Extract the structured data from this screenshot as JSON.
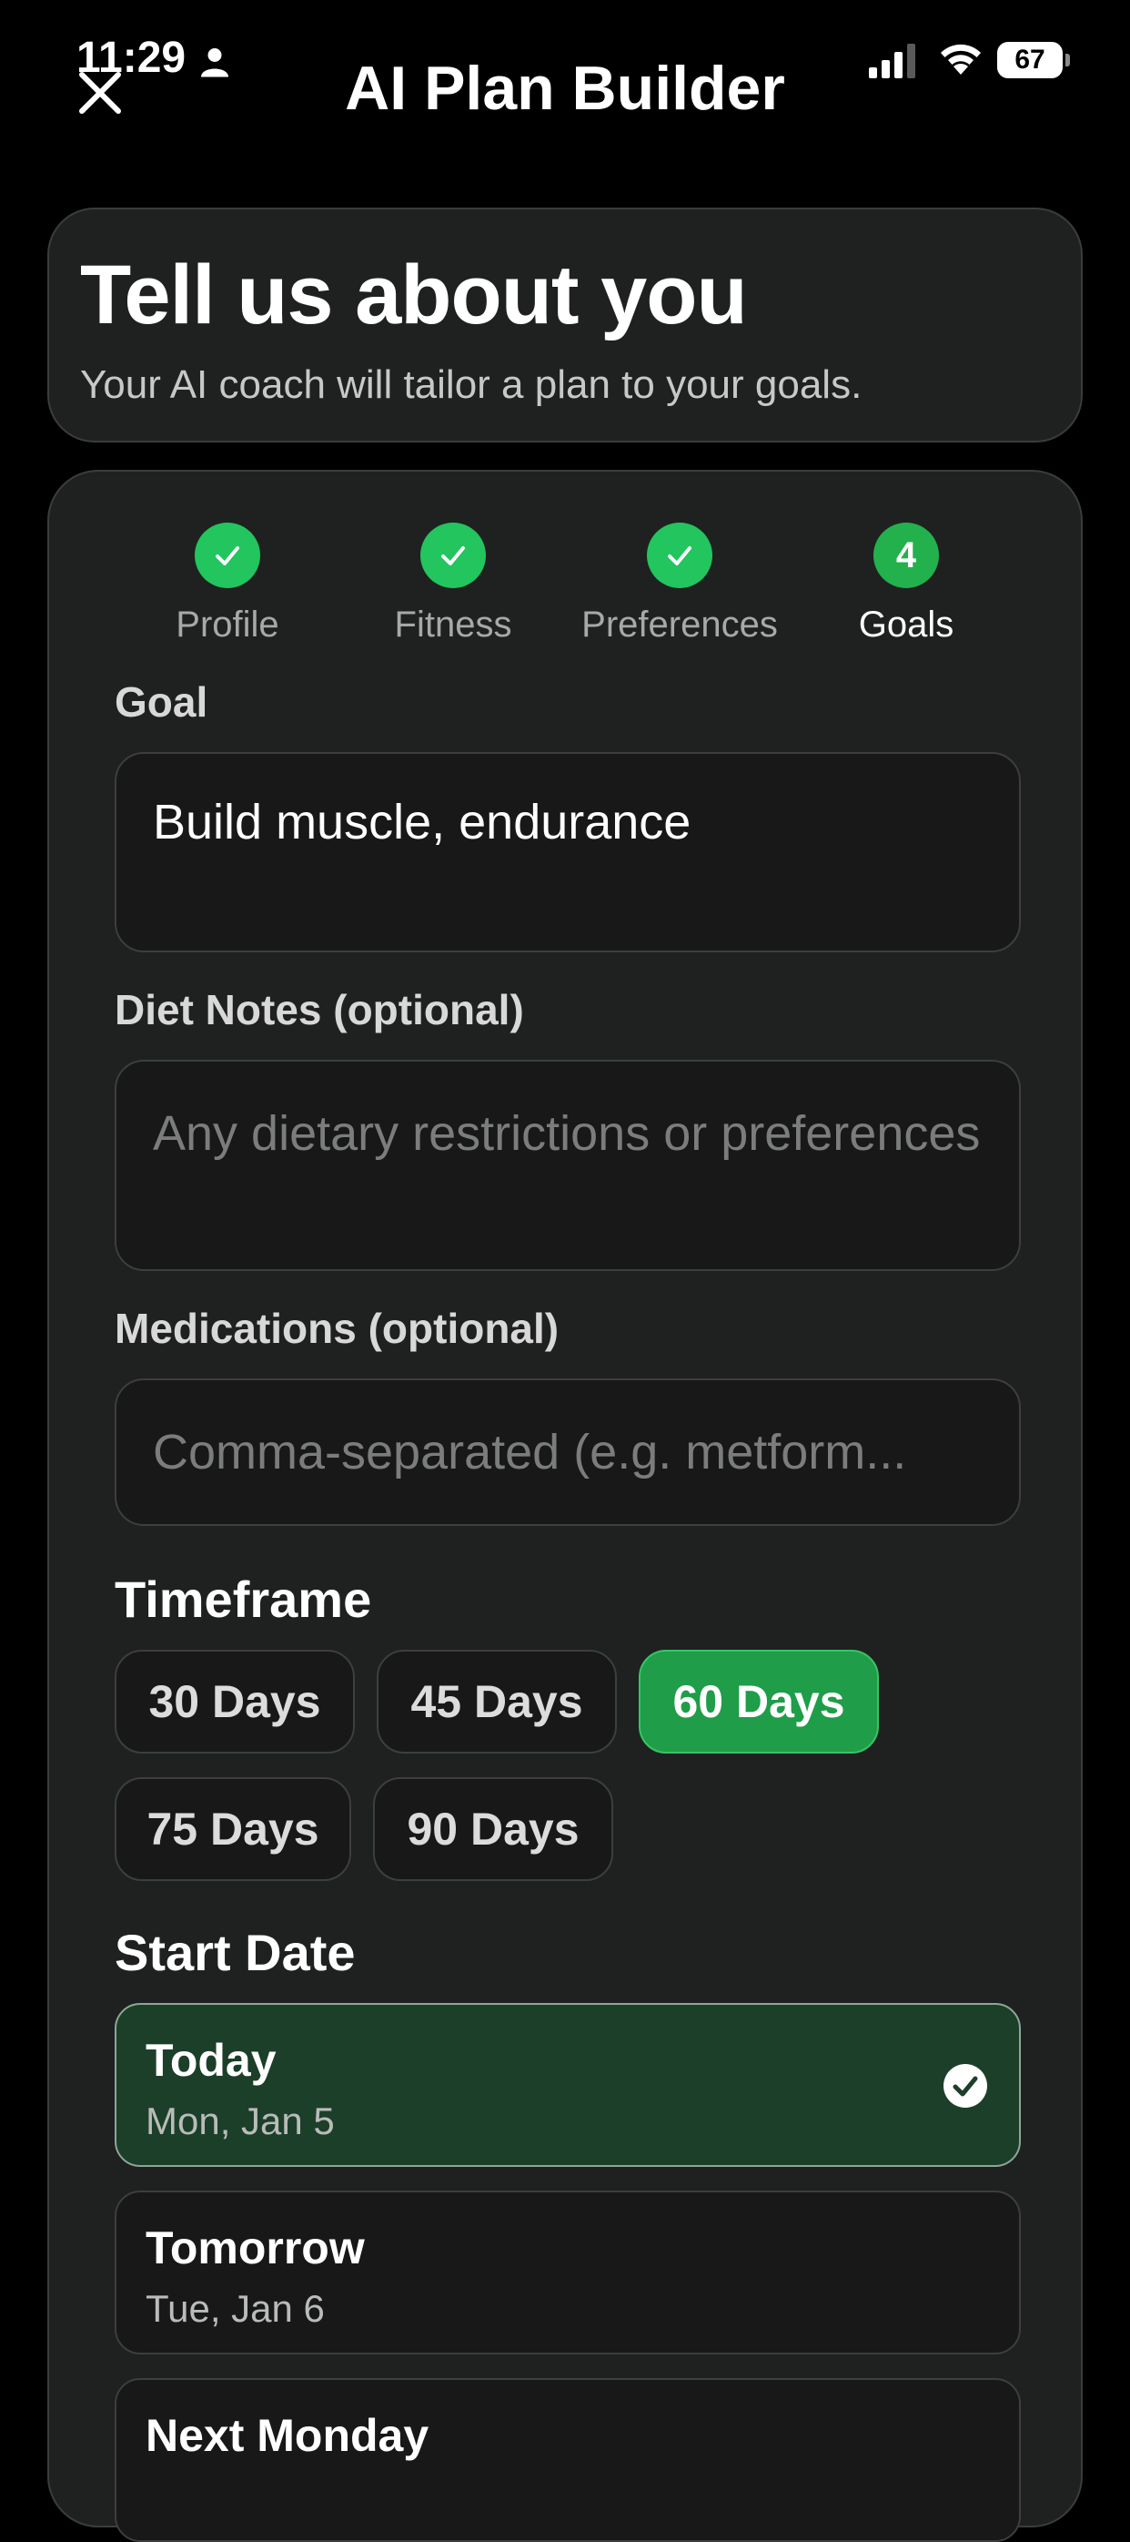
{
  "status_bar": {
    "time": "11:29",
    "battery": "67"
  },
  "header": {
    "title": "AI Plan Builder",
    "close_icon": "close-icon"
  },
  "intro": {
    "title": "Tell us about you",
    "subtitle": "Your AI coach will tailor a plan to your goals."
  },
  "steps": [
    {
      "label": "Profile",
      "state": "complete"
    },
    {
      "label": "Fitness",
      "state": "complete"
    },
    {
      "label": "Preferences",
      "state": "complete"
    },
    {
      "label": "Goals",
      "number": "4",
      "state": "active"
    }
  ],
  "form": {
    "goal_label": "Goal",
    "goal_value": "Build muscle, endurance",
    "diet_label": "Diet Notes (optional)",
    "diet_placeholder": "Any dietary restrictions or preferences",
    "medications_label": "Medications (optional)",
    "medications_placeholder": "Comma-separated (e.g. metform..."
  },
  "timeframe": {
    "label": "Timeframe",
    "options": [
      "30 Days",
      "45 Days",
      "60 Days",
      "75 Days",
      "90 Days"
    ],
    "selected": "60 Days"
  },
  "start_date": {
    "label": "Start Date",
    "options": [
      {
        "title": "Today",
        "date": "Mon, Jan 5",
        "selected": true
      },
      {
        "title": "Tomorrow",
        "date": "Tue, Jan 6",
        "selected": false
      },
      {
        "title": "Next Monday",
        "date": "",
        "selected": false
      }
    ]
  },
  "colors": {
    "accent": "#22c55e",
    "selected_chip": "#1f9d48",
    "selected_date_bg": "#1c3f29",
    "card_bg": "#1f2120",
    "background": "#000000"
  }
}
